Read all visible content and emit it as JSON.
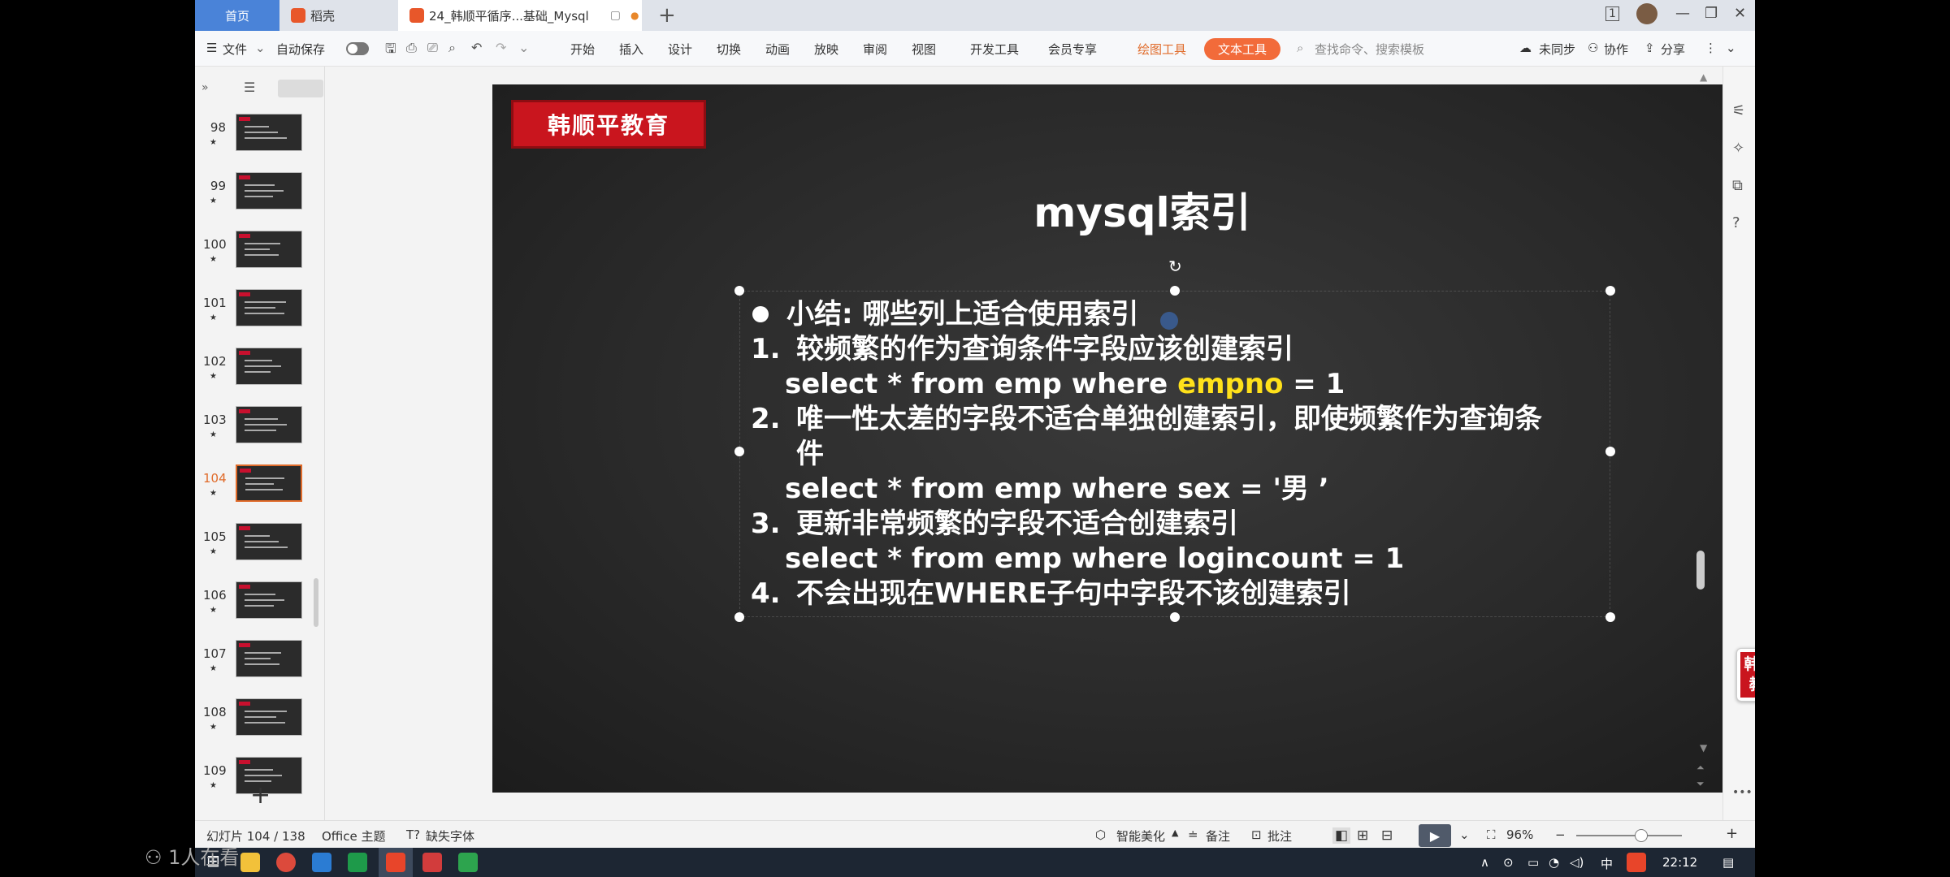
{
  "tabs": {
    "home": "首页",
    "docer": "稻壳",
    "doc": "24_韩顺平循序...基础_Mysql"
  },
  "menu": {
    "file": "文件",
    "autosave": "自动保存",
    "items": [
      "开始",
      "插入",
      "设计",
      "切换",
      "动画",
      "放映",
      "审阅",
      "视图",
      "开发工具",
      "会员专享"
    ],
    "draw_tools": "绘图工具",
    "text_tools": "文本工具",
    "search": "查找命令、搜索模板",
    "sync": "未同步",
    "collab": "协作",
    "share": "分享"
  },
  "thumbs": [
    {
      "num": "98"
    },
    {
      "num": "99"
    },
    {
      "num": "100"
    },
    {
      "num": "101"
    },
    {
      "num": "102"
    },
    {
      "num": "103"
    },
    {
      "num": "104"
    },
    {
      "num": "105"
    },
    {
      "num": "106"
    },
    {
      "num": "107"
    },
    {
      "num": "108"
    },
    {
      "num": "109"
    }
  ],
  "slide": {
    "logo": "韩顺平教育",
    "title": "mysql索引",
    "summary": "小结: 哪些列上适合使用索引",
    "item1_num": "1.",
    "item1": "较频繁的作为查询条件字段应该创建索引",
    "sql1_pre": "select * from emp where ",
    "sql1_hl": "empno",
    "sql1_post": " = 1",
    "item2_num": "2.",
    "item2": "唯一性太差的字段不适合单独创建索引，即使频繁作为查询条",
    "item2_cont": "件",
    "sql2": "select * from emp where sex = '男  ’",
    "item3_num": "3.",
    "item3": "更新非常频繁的字段不适合创建索引",
    "sql3": "select * from emp where logincount = 1",
    "item4_num": "4.",
    "item4": "不会出现在WHERE子句中字段不该创建索引"
  },
  "ime": {
    "logo_top": "韩顺平",
    "logo_bottom": "教 育",
    "lang": "中",
    "rest": "☽°, ▦ ✦ ✎"
  },
  "status": {
    "slide_count": "幻灯片 104 / 138",
    "theme": "Office 主题",
    "missing_font": "缺失字体",
    "beautify": "智能美化",
    "notes": "备注",
    "comments": "批注",
    "zoom": "96%"
  },
  "taskbar": {
    "time": "22:12",
    "ime_lang": "中",
    "watching": "1人在看"
  }
}
